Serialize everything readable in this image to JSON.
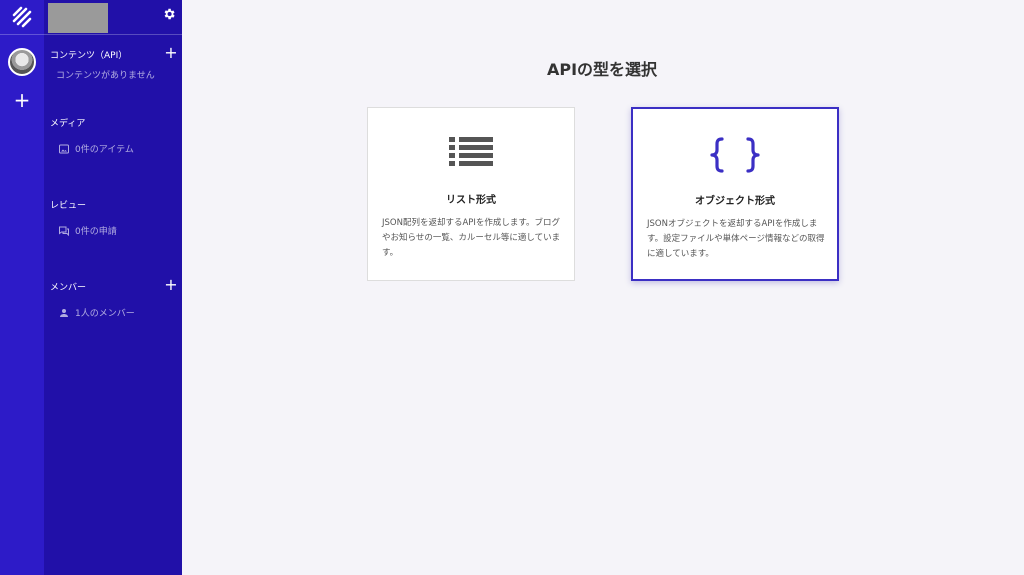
{
  "sidebar": {
    "sections": {
      "contents": {
        "title": "コンテンツ（API）",
        "empty": "コンテンツがありません"
      },
      "media": {
        "title": "メディア",
        "item": "0件のアイテム"
      },
      "review": {
        "title": "レビュー",
        "item": "0件の申請"
      },
      "members": {
        "title": "メンバー",
        "item": "1人のメンバー"
      }
    },
    "icons": {
      "settings": "gear-icon",
      "add": "plus-icon",
      "logo": "logo-icon"
    }
  },
  "main": {
    "title": "APIの型を選択",
    "cards": [
      {
        "title": "リスト形式",
        "description": "JSON配列を返却するAPIを作成します。ブログやお知らせの一覧、カルーセル等に適しています。",
        "icon": "list-icon",
        "selected": false
      },
      {
        "title": "オブジェクト形式",
        "description": "JSONオブジェクトを返却するAPIを作成します。設定ファイルや単体ページ情報などの取得に適しています。",
        "icon": "braces-icon",
        "selected": true
      }
    ]
  },
  "colors": {
    "rail": "#2d1bc8",
    "sidebar": "#2110a8",
    "accent": "#3b2fc4",
    "background": "#f5f4f9"
  }
}
